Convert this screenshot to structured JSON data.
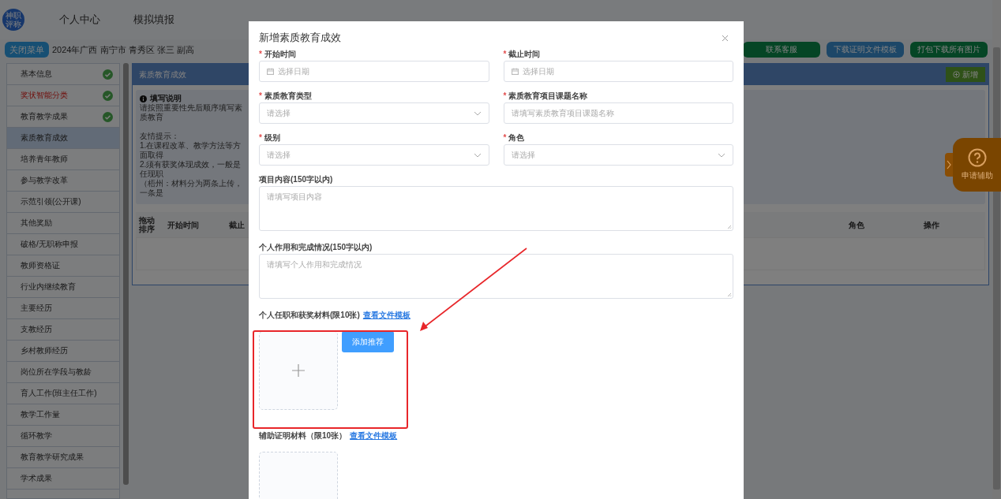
{
  "header": {
    "logo_lines": [
      "神职",
      "评称"
    ],
    "nav": [
      {
        "label": "个人中心"
      },
      {
        "label": "模拟填报"
      }
    ]
  },
  "toolbar": {
    "menu_button": "关闭菜单",
    "breadcrumb": "2024年广西 南宁市 青秀区 张三 副高",
    "buttons": [
      {
        "label": "联系客服",
        "kind": "green"
      },
      {
        "label": "下载证明文件模板",
        "kind": "blue"
      },
      {
        "label": "打包下载所有图片",
        "kind": "green"
      }
    ]
  },
  "sidebar": {
    "items": [
      {
        "label": "基本信息",
        "done": true,
        "selected": false,
        "emphasis": false
      },
      {
        "label": "奖状智能分类",
        "done": true,
        "selected": false,
        "emphasis": true
      },
      {
        "label": "教育教学成果",
        "done": true,
        "selected": false,
        "emphasis": false
      },
      {
        "label": "素质教育成效",
        "done": false,
        "selected": true,
        "emphasis": false
      },
      {
        "label": "培养青年教师",
        "done": false,
        "selected": false,
        "emphasis": false
      },
      {
        "label": "参与教学改革",
        "done": false,
        "selected": false,
        "emphasis": false
      },
      {
        "label": "示范引领(公开课)",
        "done": false,
        "selected": false,
        "emphasis": false
      },
      {
        "label": "其他奖励",
        "done": false,
        "selected": false,
        "emphasis": false
      },
      {
        "label": "破格/无职称申报",
        "done": false,
        "selected": false,
        "emphasis": false
      },
      {
        "label": "教师资格证",
        "done": false,
        "selected": false,
        "emphasis": false
      },
      {
        "label": "行业内继续教育",
        "done": false,
        "selected": false,
        "emphasis": false
      },
      {
        "label": "主要经历",
        "done": false,
        "selected": false,
        "emphasis": false
      },
      {
        "label": "支教经历",
        "done": false,
        "selected": false,
        "emphasis": false
      },
      {
        "label": "乡村教师经历",
        "done": false,
        "selected": false,
        "emphasis": false
      },
      {
        "label": "岗位所在学段与教龄",
        "done": false,
        "selected": false,
        "emphasis": false
      },
      {
        "label": "育人工作(班主任工作)",
        "done": false,
        "selected": false,
        "emphasis": false
      },
      {
        "label": "教学工作量",
        "done": false,
        "selected": false,
        "emphasis": false
      },
      {
        "label": "循环教学",
        "done": false,
        "selected": false,
        "emphasis": false
      },
      {
        "label": "教育教学研究成果",
        "done": false,
        "selected": false,
        "emphasis": false
      },
      {
        "label": "学术成果",
        "done": false,
        "selected": false,
        "emphasis": false
      }
    ]
  },
  "panel": {
    "title": "素质教育成效",
    "add_button": "新增",
    "notice": {
      "title": "填写说明",
      "intro": "请按照重要性先后顺序填写素质教育",
      "tips": [
        "友情提示：",
        "1.在课程改革、教学方法等方面取得",
        "2.须有获奖体现成效，一般是任现职",
        "（梧州：材料分为两条上传，一条是"
      ]
    },
    "table": {
      "columns": [
        "拖动排序",
        "开始时间",
        "截止",
        "角色",
        "操作"
      ]
    }
  },
  "help": {
    "label": "申请辅助"
  },
  "modal": {
    "title": "新增素质教育成效",
    "fields": [
      {
        "label": "开始时间",
        "marker": "*",
        "kind": "date",
        "placeholder": "选择日期"
      },
      {
        "label": "截止时间",
        "marker": "*",
        "kind": "date",
        "placeholder": "选择日期"
      },
      {
        "label": "素质教育类型",
        "marker": "*",
        "kind": "select",
        "placeholder": "请选择"
      },
      {
        "label": "素质教育项目课题名称",
        "marker": "*",
        "kind": "text",
        "placeholder": "请填写素质教育项目课题名称"
      },
      {
        "label": "级别",
        "marker": "*",
        "kind": "select",
        "placeholder": "请选择"
      },
      {
        "label": "角色",
        "marker": "*",
        "kind": "select",
        "placeholder": "请选择"
      },
      {
        "label": "项目内容(150字以内)",
        "kind": "textarea",
        "placeholder": "请填写项目内容"
      },
      {
        "label": "个人作用和完成情况(150字以内)",
        "kind": "textarea",
        "placeholder": "请填写个人作用和完成情况"
      }
    ],
    "uploads": [
      {
        "label": "个人任职和获奖材料(限10张)",
        "link": "查看文件模板",
        "button": "添加推荐"
      },
      {
        "label": "辅助证明材料（限10张）",
        "link": "查看文件模板"
      }
    ]
  }
}
